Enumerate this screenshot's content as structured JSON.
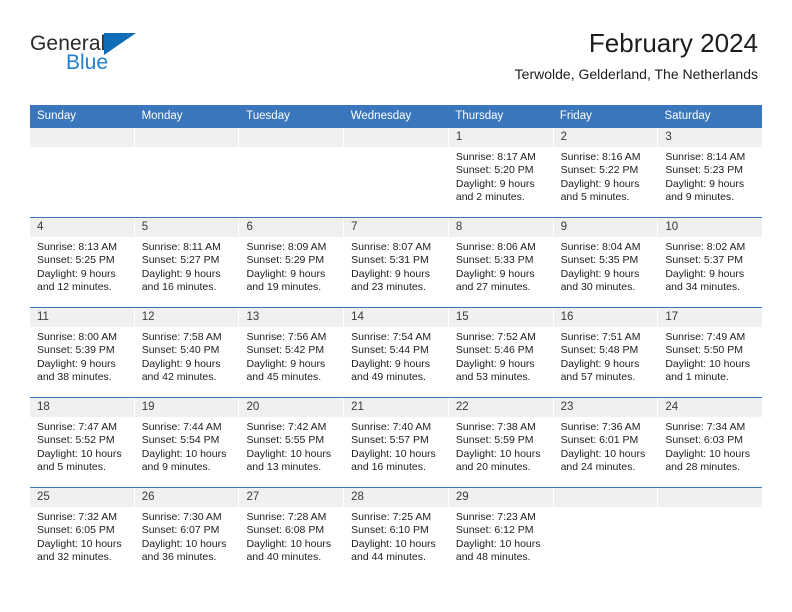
{
  "brand": {
    "name_part1": "General",
    "name_part2": "Blue",
    "triangle_color": "#0f6cb6",
    "blue_color": "#1f7fd0"
  },
  "header": {
    "title": "February 2024",
    "subtitle": "Terwolde, Gelderland, The Netherlands"
  },
  "theme": {
    "header_blue": "#3a76bc",
    "daynum_background": "#f0f0f0",
    "text_color": "#1d1d1d"
  },
  "weekdays": [
    "Sunday",
    "Monday",
    "Tuesday",
    "Wednesday",
    "Thursday",
    "Friday",
    "Saturday"
  ],
  "weeks": [
    [
      {
        "day": "",
        "lines": []
      },
      {
        "day": "",
        "lines": []
      },
      {
        "day": "",
        "lines": []
      },
      {
        "day": "",
        "lines": []
      },
      {
        "day": "1",
        "lines": [
          "Sunrise: 8:17 AM",
          "Sunset: 5:20 PM",
          "Daylight: 9 hours",
          "and 2 minutes."
        ]
      },
      {
        "day": "2",
        "lines": [
          "Sunrise: 8:16 AM",
          "Sunset: 5:22 PM",
          "Daylight: 9 hours",
          "and 5 minutes."
        ]
      },
      {
        "day": "3",
        "lines": [
          "Sunrise: 8:14 AM",
          "Sunset: 5:23 PM",
          "Daylight: 9 hours",
          "and 9 minutes."
        ]
      }
    ],
    [
      {
        "day": "4",
        "lines": [
          "Sunrise: 8:13 AM",
          "Sunset: 5:25 PM",
          "Daylight: 9 hours",
          "and 12 minutes."
        ]
      },
      {
        "day": "5",
        "lines": [
          "Sunrise: 8:11 AM",
          "Sunset: 5:27 PM",
          "Daylight: 9 hours",
          "and 16 minutes."
        ]
      },
      {
        "day": "6",
        "lines": [
          "Sunrise: 8:09 AM",
          "Sunset: 5:29 PM",
          "Daylight: 9 hours",
          "and 19 minutes."
        ]
      },
      {
        "day": "7",
        "lines": [
          "Sunrise: 8:07 AM",
          "Sunset: 5:31 PM",
          "Daylight: 9 hours",
          "and 23 minutes."
        ]
      },
      {
        "day": "8",
        "lines": [
          "Sunrise: 8:06 AM",
          "Sunset: 5:33 PM",
          "Daylight: 9 hours",
          "and 27 minutes."
        ]
      },
      {
        "day": "9",
        "lines": [
          "Sunrise: 8:04 AM",
          "Sunset: 5:35 PM",
          "Daylight: 9 hours",
          "and 30 minutes."
        ]
      },
      {
        "day": "10",
        "lines": [
          "Sunrise: 8:02 AM",
          "Sunset: 5:37 PM",
          "Daylight: 9 hours",
          "and 34 minutes."
        ]
      }
    ],
    [
      {
        "day": "11",
        "lines": [
          "Sunrise: 8:00 AM",
          "Sunset: 5:39 PM",
          "Daylight: 9 hours",
          "and 38 minutes."
        ]
      },
      {
        "day": "12",
        "lines": [
          "Sunrise: 7:58 AM",
          "Sunset: 5:40 PM",
          "Daylight: 9 hours",
          "and 42 minutes."
        ]
      },
      {
        "day": "13",
        "lines": [
          "Sunrise: 7:56 AM",
          "Sunset: 5:42 PM",
          "Daylight: 9 hours",
          "and 45 minutes."
        ]
      },
      {
        "day": "14",
        "lines": [
          "Sunrise: 7:54 AM",
          "Sunset: 5:44 PM",
          "Daylight: 9 hours",
          "and 49 minutes."
        ]
      },
      {
        "day": "15",
        "lines": [
          "Sunrise: 7:52 AM",
          "Sunset: 5:46 PM",
          "Daylight: 9 hours",
          "and 53 minutes."
        ]
      },
      {
        "day": "16",
        "lines": [
          "Sunrise: 7:51 AM",
          "Sunset: 5:48 PM",
          "Daylight: 9 hours",
          "and 57 minutes."
        ]
      },
      {
        "day": "17",
        "lines": [
          "Sunrise: 7:49 AM",
          "Sunset: 5:50 PM",
          "Daylight: 10 hours",
          "and 1 minute."
        ]
      }
    ],
    [
      {
        "day": "18",
        "lines": [
          "Sunrise: 7:47 AM",
          "Sunset: 5:52 PM",
          "Daylight: 10 hours",
          "and 5 minutes."
        ]
      },
      {
        "day": "19",
        "lines": [
          "Sunrise: 7:44 AM",
          "Sunset: 5:54 PM",
          "Daylight: 10 hours",
          "and 9 minutes."
        ]
      },
      {
        "day": "20",
        "lines": [
          "Sunrise: 7:42 AM",
          "Sunset: 5:55 PM",
          "Daylight: 10 hours",
          "and 13 minutes."
        ]
      },
      {
        "day": "21",
        "lines": [
          "Sunrise: 7:40 AM",
          "Sunset: 5:57 PM",
          "Daylight: 10 hours",
          "and 16 minutes."
        ]
      },
      {
        "day": "22",
        "lines": [
          "Sunrise: 7:38 AM",
          "Sunset: 5:59 PM",
          "Daylight: 10 hours",
          "and 20 minutes."
        ]
      },
      {
        "day": "23",
        "lines": [
          "Sunrise: 7:36 AM",
          "Sunset: 6:01 PM",
          "Daylight: 10 hours",
          "and 24 minutes."
        ]
      },
      {
        "day": "24",
        "lines": [
          "Sunrise: 7:34 AM",
          "Sunset: 6:03 PM",
          "Daylight: 10 hours",
          "and 28 minutes."
        ]
      }
    ],
    [
      {
        "day": "25",
        "lines": [
          "Sunrise: 7:32 AM",
          "Sunset: 6:05 PM",
          "Daylight: 10 hours",
          "and 32 minutes."
        ]
      },
      {
        "day": "26",
        "lines": [
          "Sunrise: 7:30 AM",
          "Sunset: 6:07 PM",
          "Daylight: 10 hours",
          "and 36 minutes."
        ]
      },
      {
        "day": "27",
        "lines": [
          "Sunrise: 7:28 AM",
          "Sunset: 6:08 PM",
          "Daylight: 10 hours",
          "and 40 minutes."
        ]
      },
      {
        "day": "28",
        "lines": [
          "Sunrise: 7:25 AM",
          "Sunset: 6:10 PM",
          "Daylight: 10 hours",
          "and 44 minutes."
        ]
      },
      {
        "day": "29",
        "lines": [
          "Sunrise: 7:23 AM",
          "Sunset: 6:12 PM",
          "Daylight: 10 hours",
          "and 48 minutes."
        ]
      },
      {
        "day": "",
        "lines": []
      },
      {
        "day": "",
        "lines": []
      }
    ]
  ]
}
